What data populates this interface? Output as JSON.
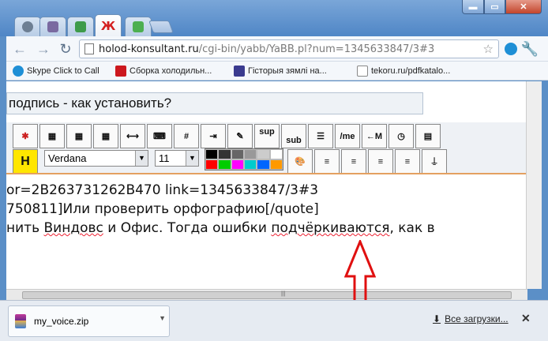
{
  "browser": {
    "url_host": "holod-konsultant.ru",
    "url_path": "/cgi-bin/yabb/YaBB.pl?num=1345633847/3#3"
  },
  "tab_logo_text": "Ж",
  "bookmarks": [
    {
      "label": "Skype Click to Call",
      "icon": "skype-icon",
      "color": "#1e8fd6"
    },
    {
      "label": "Сборка холодильн...",
      "icon": "youtube-icon",
      "color": "#cc181e"
    },
    {
      "label": "Гісторыя зямлі на...",
      "icon": "site-icon",
      "color": "#3b3b8f"
    },
    {
      "label": "tekoru.ru/pdfkatalo...",
      "icon": "page-icon",
      "color": "#888888"
    }
  ],
  "editor": {
    "subject": "подпись - как установить?",
    "font": "Verdana",
    "size": "11",
    "toolbar_labels": [
      "#",
      "sup",
      "sub",
      "/me",
      "←M",
      "H"
    ],
    "palette": [
      "#000000",
      "#333333",
      "#666666",
      "#999999",
      "#cccccc",
      "#ffffff",
      "#ff0000",
      "#00cc00",
      "#ff00ff",
      "#00cccc",
      "#0066ff",
      "#ff9900"
    ]
  },
  "body_text": {
    "line1": "or=2B263731262B470 link=1345633847/3#3",
    "line2": "750811]Или проверить орфографию[/quote]",
    "line3_a": "нить ",
    "line3_b": "Виндовс",
    "line3_c": " и Офис. Тогда ошибки ",
    "line3_d": "подчёркиваются",
    "line3_e": ", как в"
  },
  "downloads": {
    "file": "my_voice.zip",
    "all_label": "Все загрузки..."
  }
}
